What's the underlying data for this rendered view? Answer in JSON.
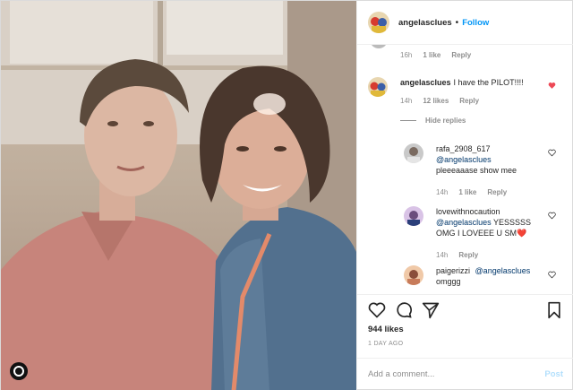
{
  "header": {
    "username": "angelasclues",
    "separator": "•",
    "follow_label": "Follow"
  },
  "comments": {
    "top_meta": {
      "time": "16h",
      "likes": "1 like",
      "reply": "Reply"
    },
    "main": {
      "username": "angelasclues",
      "text": "I have the PILOT!!!!",
      "time": "14h",
      "likes": "12 likes",
      "reply": "Reply",
      "liked": true
    },
    "hide_replies": "Hide replies",
    "replies": [
      {
        "username": "rafa_2908_617",
        "mention": "@angelasclues",
        "text": "pleeeaaase show mee",
        "time": "14h",
        "likes": "1 like",
        "reply": "Reply"
      },
      {
        "username": "lovewithnocaution",
        "mention": "@angelasclues",
        "text": "YESSSSS OMG I LOVEEE U SM",
        "emoji": "❤️",
        "time": "14h",
        "reply": "Reply"
      },
      {
        "username": "paigerizzi",
        "mention": "@angelasclues",
        "text": "omggg"
      }
    ]
  },
  "actions": {
    "icons": [
      "heart-icon",
      "comment-icon",
      "share-icon",
      "bookmark-icon"
    ],
    "likes": "944 likes",
    "time_ago": "1 DAY AGO",
    "add_comment_placeholder": "Add a comment...",
    "post_label": "Post"
  },
  "colors": {
    "accent": "#0095f6",
    "liked_heart": "#ed4956",
    "post_disabled": "#b2dffc"
  }
}
